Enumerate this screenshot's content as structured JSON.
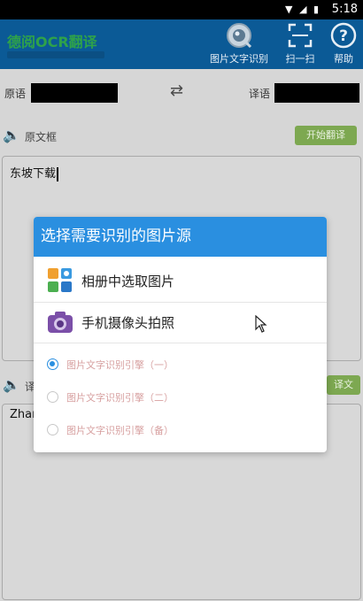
{
  "status_bar": {
    "time": "5:18"
  },
  "app_bar": {
    "title": "德阅OCR翻译",
    "buttons": [
      {
        "label": "图片文字识别",
        "icon": "camera-lens-icon"
      },
      {
        "label": "扫一扫",
        "icon": "scan-icon"
      },
      {
        "label": "帮助",
        "icon": "help-icon"
      }
    ]
  },
  "language": {
    "source_label": "原语",
    "target_label": "译语",
    "swap_icon": "swap-arrows-icon"
  },
  "source_section": {
    "label": "原文框",
    "translate_button": "开始翻译",
    "text": "东坡下载"
  },
  "target_section": {
    "label_fragment": "译",
    "button_fragment": "译文",
    "text": "Zhan"
  },
  "dialog": {
    "title": "选择需要识别的图片源",
    "options": [
      {
        "label": "相册中选取图片",
        "icon": "gallery-icon"
      },
      {
        "label": "手机摄像头拍照",
        "icon": "camera-icon"
      }
    ],
    "engines": [
      {
        "label": "图片文字识别引擎（一）",
        "selected": true
      },
      {
        "label": "图片文字识别引擎（二）",
        "selected": false
      },
      {
        "label": "图片文字识别引擎（备）",
        "selected": false
      }
    ]
  },
  "colors": {
    "app_bar": "#0b5a96",
    "dialog_header": "#2a8fe0",
    "green_button": "#7da851"
  }
}
